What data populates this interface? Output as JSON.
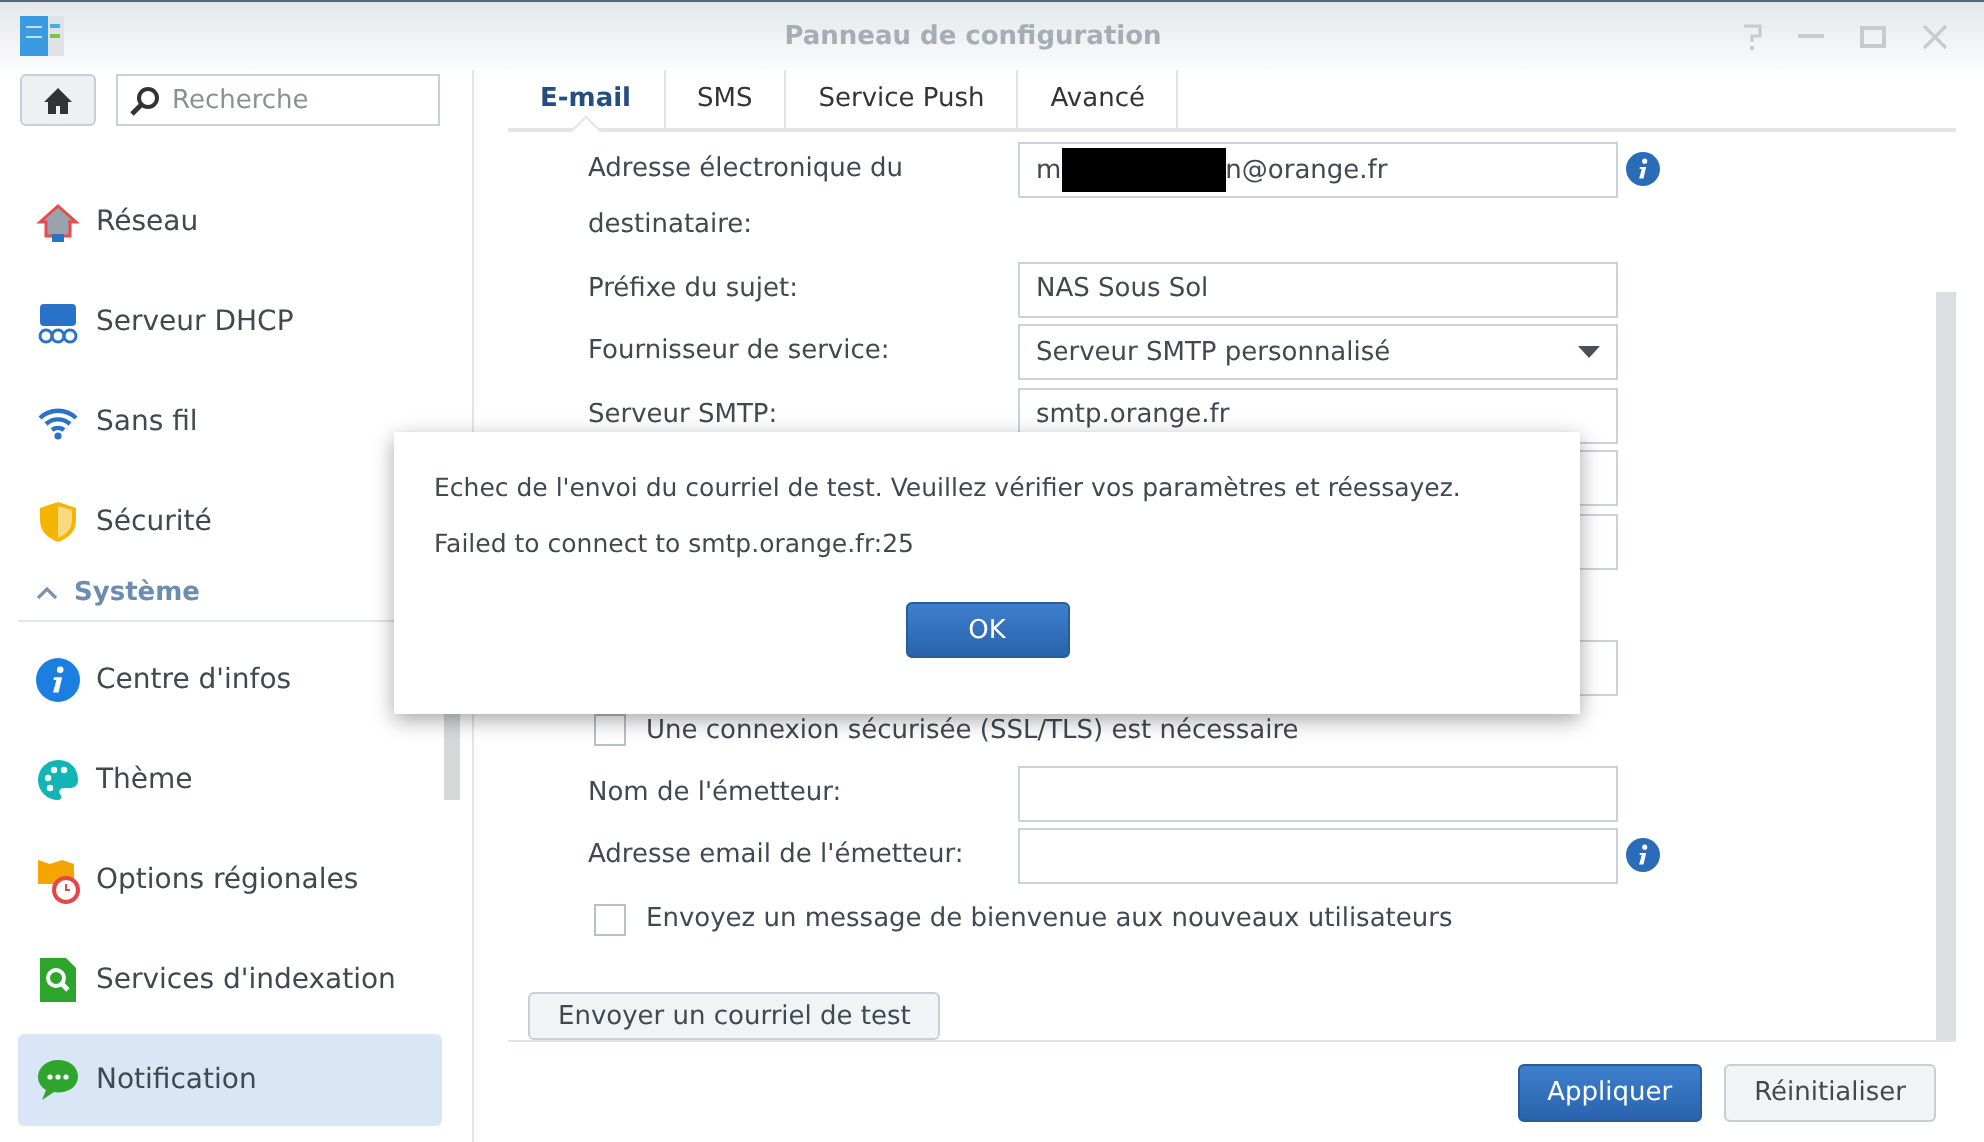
{
  "window": {
    "title": "Panneau de configuration"
  },
  "sidebar": {
    "search": {
      "placeholder": "Recherche"
    },
    "items": [
      {
        "kind": "item",
        "label": "Réseau",
        "selected": false
      },
      {
        "kind": "item",
        "label": "Serveur DHCP",
        "selected": false
      },
      {
        "kind": "item",
        "label": "Sans fil",
        "selected": false
      },
      {
        "kind": "item",
        "label": "Sécurité",
        "selected": false
      },
      {
        "kind": "section",
        "label": "Système",
        "expanded": true
      },
      {
        "kind": "item",
        "label": "Centre d'infos",
        "selected": false
      },
      {
        "kind": "item",
        "label": "Thème",
        "selected": false
      },
      {
        "kind": "item",
        "label": "Options régionales",
        "selected": false
      },
      {
        "kind": "item",
        "label": "Services d'indexation",
        "selected": false
      },
      {
        "kind": "item",
        "label": "Notification",
        "selected": true
      }
    ]
  },
  "tabs": [
    {
      "label": "E-mail",
      "selected": true
    },
    {
      "label": "SMS",
      "selected": false
    },
    {
      "label": "Service Push",
      "selected": false
    },
    {
      "label": "Avancé",
      "selected": false
    }
  ],
  "form": {
    "rows": [
      {
        "kind": "redacted-field",
        "label": "Adresse électronique du destinataire:",
        "value_prefix": "m",
        "value_suffix": "n@orange.fr",
        "info": true
      },
      {
        "kind": "field",
        "label": "Préfixe du sujet:",
        "value": "NAS Sous Sol",
        "info": false
      },
      {
        "kind": "select",
        "label": "Fournisseur de service:",
        "value": "Serveur SMTP personnalisé"
      },
      {
        "kind": "field",
        "label": "Serveur SMTP:",
        "value": "smtp.orange.fr",
        "info": false
      },
      {
        "kind": "field",
        "info": false
      },
      {
        "kind": "field",
        "info": false
      },
      {
        "kind": "field",
        "info": false
      },
      {
        "kind": "checkbox",
        "label": "Une connexion sécurisée (SSL/TLS) est nécessaire",
        "checked": false
      },
      {
        "kind": "field",
        "label": "Nom de l'émetteur:",
        "info": false
      },
      {
        "kind": "field",
        "label": "Adresse email de l'émetteur:",
        "info": true
      },
      {
        "kind": "checkbox",
        "label": "Envoyez un message de bienvenue aux nouveaux utilisateurs",
        "checked": false
      }
    ],
    "test_button": "Envoyer un courriel de test"
  },
  "footer": {
    "buttons": [
      {
        "label": "Appliquer",
        "primary": true
      },
      {
        "label": "Réinitialiser",
        "primary": false
      }
    ]
  },
  "dialog": {
    "lines": [
      "Echec de l'envoi du courriel de test. Veuillez vérifier vos paramètres et réessayez.",
      "Failed to connect to smtp.orange.fr:25"
    ],
    "button": "OK"
  }
}
